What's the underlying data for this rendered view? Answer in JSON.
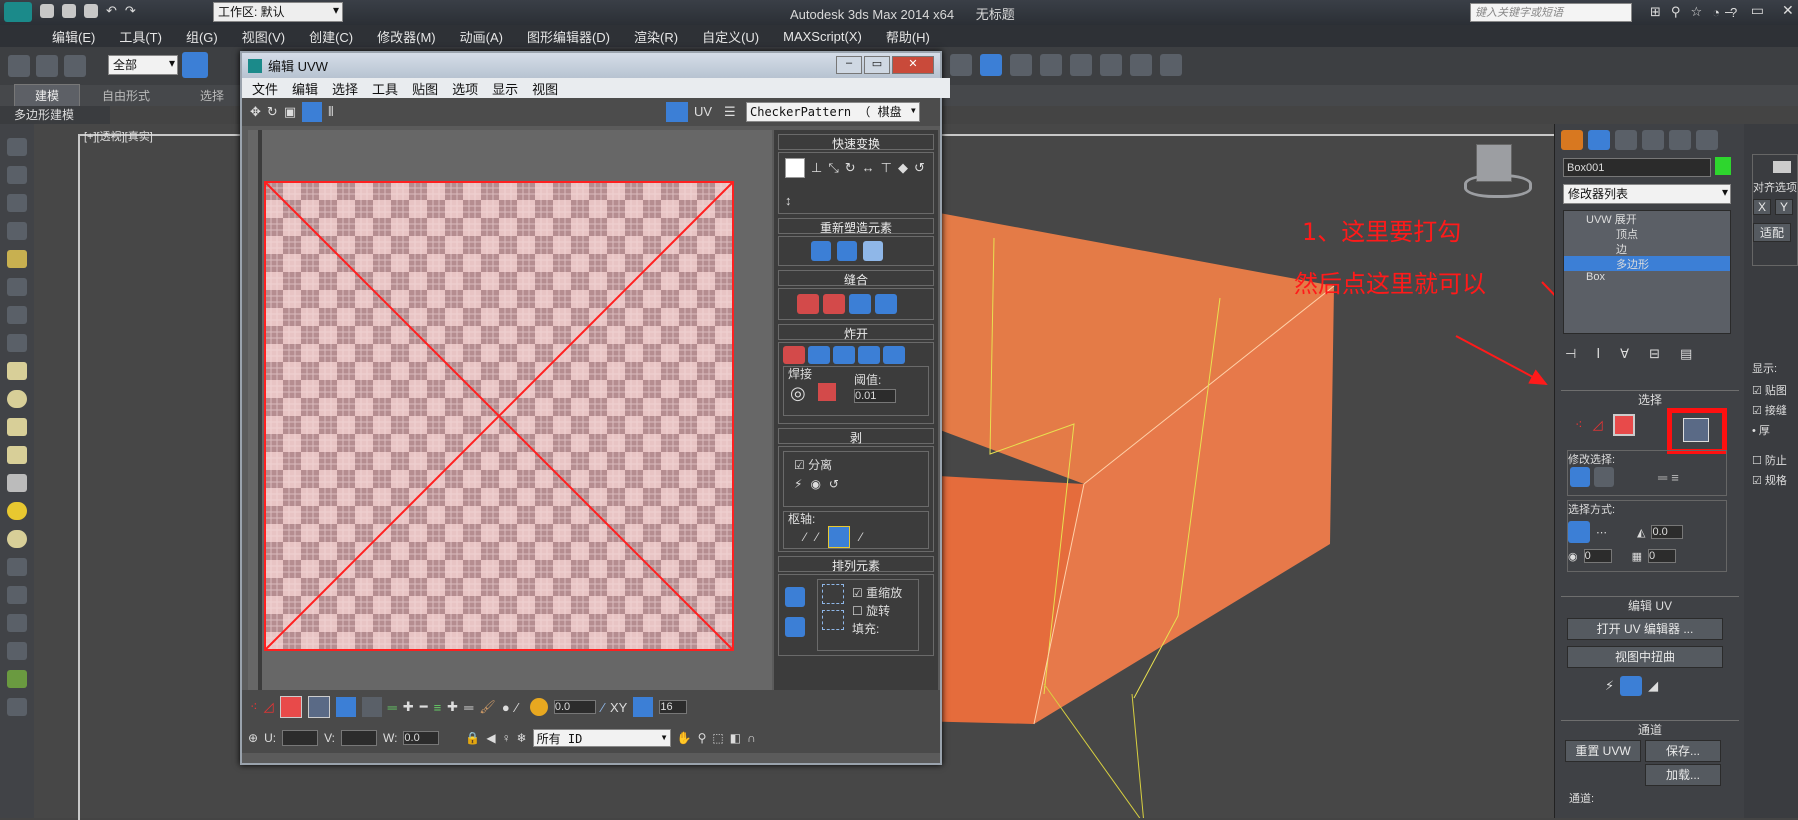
{
  "app": {
    "window_title": "Autodesk 3ds Max  2014 x64",
    "doc_title": "无标题",
    "workspace_label": "工作区: 默认",
    "search_placeholder": "键入关键字或短语"
  },
  "menu": [
    "编辑(E)",
    "工具(T)",
    "组(G)",
    "视图(V)",
    "创建(C)",
    "修改器(M)",
    "动画(A)",
    "图形编辑器(D)",
    "渲染(R)",
    "自定义(U)",
    "MAXScript(X)",
    "帮助(H)"
  ],
  "toolbar": {
    "selection_filter": "全部"
  },
  "ribbon": {
    "tabs": [
      "建模",
      "自由形式",
      "选择"
    ],
    "sub_label": "多边形建模"
  },
  "viewport": {
    "label": "[+][透视][真实]"
  },
  "uvw_editor": {
    "title": "编辑 UVW",
    "menu": [
      "文件",
      "编辑",
      "选择",
      "工具",
      "贴图",
      "选项",
      "显示",
      "视图"
    ],
    "uv_label": "UV",
    "texture_dropdown": "CheckerPattern （ 棋盘",
    "sections": {
      "quick_transform": "快速变换",
      "reshape": "重新塑造元素",
      "stitch": "缝合",
      "explode": "炸开",
      "weld": "焊接",
      "threshold_label": "阈值:",
      "threshold_value": "0.01",
      "peel": "剥",
      "detach_label": "分离",
      "pivot_label": "枢轴:",
      "arrange": "排列元素",
      "rescale_label": "重缩放",
      "rotate_label": "旋转",
      "padding_label": "填充:"
    },
    "bottom": {
      "spin_value": "0.0",
      "xy_label": "XY",
      "zoom_value": "16",
      "u_label": "U:",
      "v_label": "V:",
      "w_label": "W:",
      "w_value": "0.0",
      "id_dropdown": "所有 ID"
    }
  },
  "command_panel": {
    "object_name": "Box001",
    "modifier_list": "修改器列表",
    "stack": [
      "UVW 展开",
      "顶点",
      "边",
      "多边形",
      "Box"
    ],
    "selection_head": "选择",
    "modify_selection": "修改选择:",
    "selection_method": "选择方式:",
    "spin_a": "0.0",
    "spin_b": "0",
    "spin_c": "0",
    "edit_uv_head": "编辑 UV",
    "open_uv_editor": "打开 UV 编辑器 ...",
    "view_tweak": "视图中扭曲",
    "channel_head": "通道",
    "reset_uvw": "重置 UVW",
    "save": "保存...",
    "load": "加载...",
    "channel_label": "通道:"
  },
  "far_right": {
    "align_label": "对齐选项",
    "x": "X",
    "y": "Y",
    "fit": "适配",
    "display": "显示:",
    "opt1": "贴图",
    "opt2": "接缝",
    "opt3": "厚",
    "opt4": "防止",
    "opt5": "规格"
  },
  "annotations": {
    "line1": "1、这里要打勾",
    "line2": "然后点这里就可以"
  },
  "colors": {
    "box_orange": "#e87a45",
    "accent_blue": "#3c7fd6",
    "annotation_red": "#ff1a1a",
    "checker_pink": "#e5b5b7",
    "checker_dark": "#b98a8c"
  }
}
